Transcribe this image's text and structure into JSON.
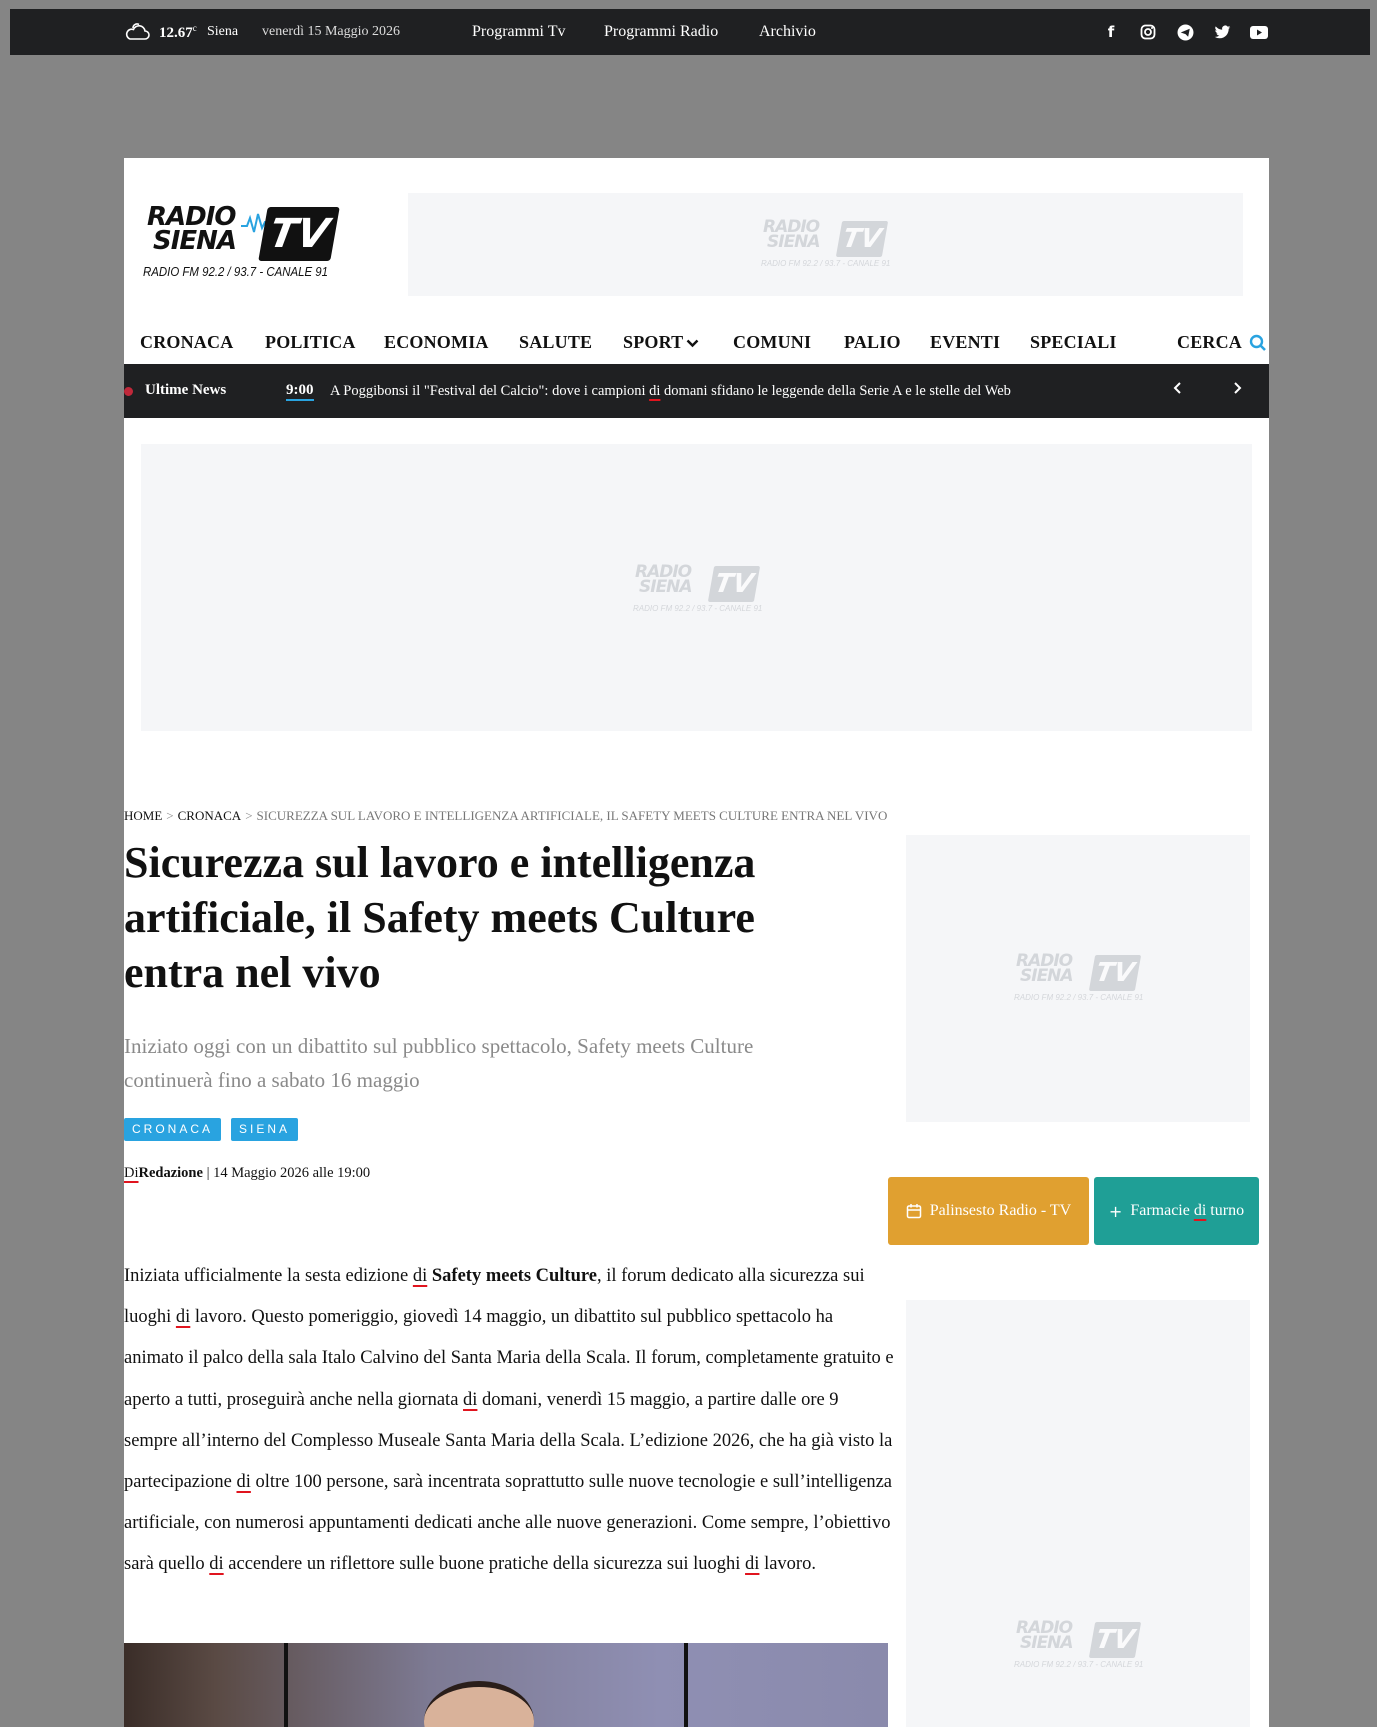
{
  "topbar": {
    "temperature": "12.67",
    "temperature_unit": "c",
    "city": "Siena",
    "date": "venerdì 15 Maggio 2026",
    "links": [
      "Programmi Tv",
      "Programmi Radio",
      "Archivio"
    ],
    "social_icons": [
      "facebook-icon",
      "instagram-icon",
      "telegram-icon",
      "twitter-icon",
      "youtube-icon"
    ]
  },
  "logo": {
    "line1": "RADIO",
    "line2": "SIENA",
    "tv": "TV",
    "subtitle": "RADIO FM 92.2 / 93.7 - CANALE 91"
  },
  "nav": {
    "items": [
      "CRONACA",
      "POLITICA",
      "ECONOMIA",
      "SALUTE",
      "SPORT",
      "COMUNI",
      "PALIO",
      "EVENTI",
      "SPECIALI"
    ],
    "search_label": "CERCA"
  },
  "ticker": {
    "label": "Ultime News",
    "time": "9:00",
    "headline_before": "A Poggibonsi il \"Festival del Calcio\": dove i campioni",
    "headline_di": "di",
    "headline_after": "domani sfidano le leggende della Serie A e le stelle del Web"
  },
  "breadcrumb": {
    "home": "HOME",
    "section": "CRONACA",
    "current": "SICUREZZA SUL LAVORO E INTELLIGENZA ARTIFICIALE, IL SAFETY MEETS CULTURE ENTRA NEL VIVO",
    "separator": ">"
  },
  "article": {
    "title": "Sicurezza sul lavoro e intelligenza artificiale, il Safety meets Culture entra nel vivo",
    "subtitle": "Iniziato oggi con un dibattito sul pubblico spettacolo, Safety meets Culture continuerà fino a sabato 16 maggio",
    "tags": [
      "CRONACA",
      "SIENA"
    ],
    "byline_prefix": "Di",
    "author": "Redazione",
    "published": "| 14 Maggio 2026 alle 19:00",
    "body": {
      "p1": "Iniziata ufficialmente la sesta edizione",
      "di": "di",
      "bold": "Safety meets Culture",
      "p2": ", il forum dedicato alla sicurezza sui luoghi",
      "p3": "lavoro. Questo pomeriggio, giovedì 14 maggio, un dibattito sul pubblico spettacolo ha animato il palco della sala Italo Calvino del Santa Maria della Scala. Il forum, completamente gratuito e aperto a tutti, proseguirà anche nella giornata",
      "p4": "domani, venerdì 15 maggio, a partire dalle ore 9 sempre all’interno del Complesso Museale Santa Maria della Scala. L’edizione 2026, che ha già visto la partecipazione",
      "p5": "oltre 100 persone, sarà incentrata soprattutto sulle nuove tecnologie e sull’intelligenza artificiale, con numerosi appuntamenti dedicati anche alle nuove generazioni. Come sempre, l’obiettivo sarà quello",
      "p6": "accendere un riflettore sulle buone pratiche della sicurezza sui luoghi",
      "p7": "lavoro."
    }
  },
  "sidebar": {
    "palinsesto_label": "Palinsesto Radio - TV",
    "farmacie_before": "Farmacie",
    "farmacie_di": "di",
    "farmacie_after": "turno",
    "palinsesto_color": "#e0a030",
    "farmacie_color": "#1f9f96"
  },
  "colors": {
    "accent": "#29a3e0",
    "dark": "#1f2022",
    "live_dot": "#c0283a"
  }
}
